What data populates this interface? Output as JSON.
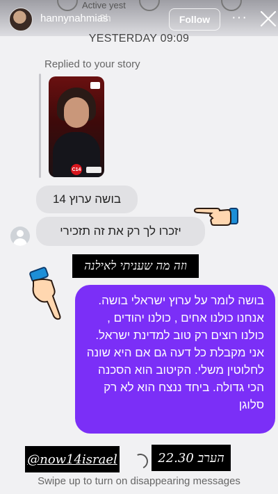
{
  "header": {
    "username": "hannynahmias",
    "time": "3h",
    "active_status": "Active yest",
    "follow_label": "Follow",
    "more_label": "···"
  },
  "thread": {
    "date_label": "YESTERDAY 09:09",
    "replied_label": "Replied to your story",
    "story_logo_text": "C14"
  },
  "messages": {
    "gray_1": "בושה ערוץ 14",
    "gray_2": "יזכרו לך רק את זה תזכירי",
    "sticker_top": "וזה מה שעניתי לאילנה",
    "purple": "בושה לומר על ערוץ ישראלי בושה. אנחנו כולנו אחים , כולנו יהודים , כולנו רוצים רק טוב למדינת ישראל. אני מקבלת כל דעה גם אם היא שונה לחלוטין משלי. הקיטוב הוא הסכנה הכי גדולה. ביחד ננצח הוא לא רק סלוגן"
  },
  "stickers": {
    "handle": "@now14israel",
    "time_note": "הערב 22.30"
  },
  "footer": {
    "text": "Swipe up to turn on disappearing messages"
  },
  "colors": {
    "purple_bubble": "#7b2ff7",
    "gray_bubble": "#e1e1e4",
    "background": "#f1f1f3"
  }
}
